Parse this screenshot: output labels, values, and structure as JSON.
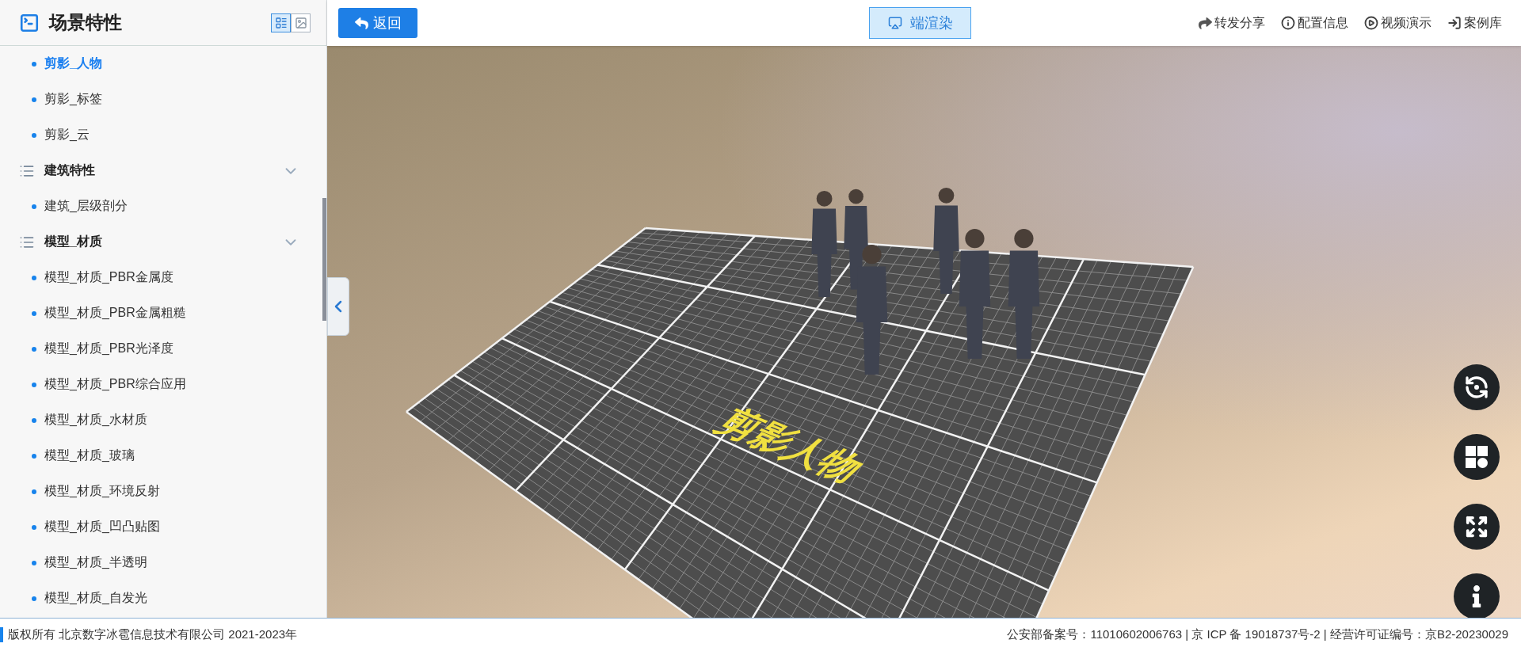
{
  "sidebar": {
    "title": "场景特性",
    "view_buttons": [
      {
        "kind": "list",
        "selected": true
      },
      {
        "kind": "image",
        "selected": false
      }
    ],
    "entries": [
      {
        "kind": "leaf",
        "label": "剪影_人物",
        "selected": true
      },
      {
        "kind": "leaf",
        "label": "剪影_标签",
        "selected": false
      },
      {
        "kind": "leaf",
        "label": "剪影_云",
        "selected": false
      },
      {
        "kind": "group",
        "label": "建筑特性",
        "expanded": true,
        "children": [
          {
            "kind": "leaf",
            "label": "建筑_层级剖分",
            "selected": false
          }
        ]
      },
      {
        "kind": "group",
        "label": "模型_材质",
        "expanded": true,
        "children": [
          {
            "kind": "leaf",
            "label": "模型_材质_PBR金属度",
            "selected": false
          },
          {
            "kind": "leaf",
            "label": "模型_材质_PBR金属粗糙",
            "selected": false
          },
          {
            "kind": "leaf",
            "label": "模型_材质_PBR光泽度",
            "selected": false
          },
          {
            "kind": "leaf",
            "label": "模型_材质_PBR综合应用",
            "selected": false
          },
          {
            "kind": "leaf",
            "label": "模型_材质_水材质",
            "selected": false
          },
          {
            "kind": "leaf",
            "label": "模型_材质_玻璃",
            "selected": false
          },
          {
            "kind": "leaf",
            "label": "模型_材质_环境反射",
            "selected": false
          },
          {
            "kind": "leaf",
            "label": "模型_材质_凹凸贴图",
            "selected": false
          },
          {
            "kind": "leaf",
            "label": "模型_材质_半透明",
            "selected": false
          },
          {
            "kind": "leaf",
            "label": "模型_材质_自发光",
            "selected": false
          }
        ]
      }
    ]
  },
  "top_bar": {
    "back_button": "返回",
    "render_toggle": {
      "label": "端渲染",
      "selected": true
    },
    "actions": [
      {
        "kind": "share",
        "label": "转发分享"
      },
      {
        "kind": "info",
        "label": "配置信息"
      },
      {
        "kind": "video",
        "label": "视频演示"
      },
      {
        "kind": "library",
        "label": "案例库"
      }
    ]
  },
  "scene": {
    "floor_label": "剪影人物"
  },
  "scene_controls": [
    {
      "kind": "rotate"
    },
    {
      "kind": "layout"
    },
    {
      "kind": "fullscreen"
    },
    {
      "kind": "info"
    }
  ],
  "footer": {
    "copyright": "版权所有 北京数字冰雹信息技术有限公司 2021-2023年",
    "registration": "公安部备案号：11010602006763 | 京 ICP 备 19018737号-2 | 经营许可证编号：京B2-20230029"
  }
}
